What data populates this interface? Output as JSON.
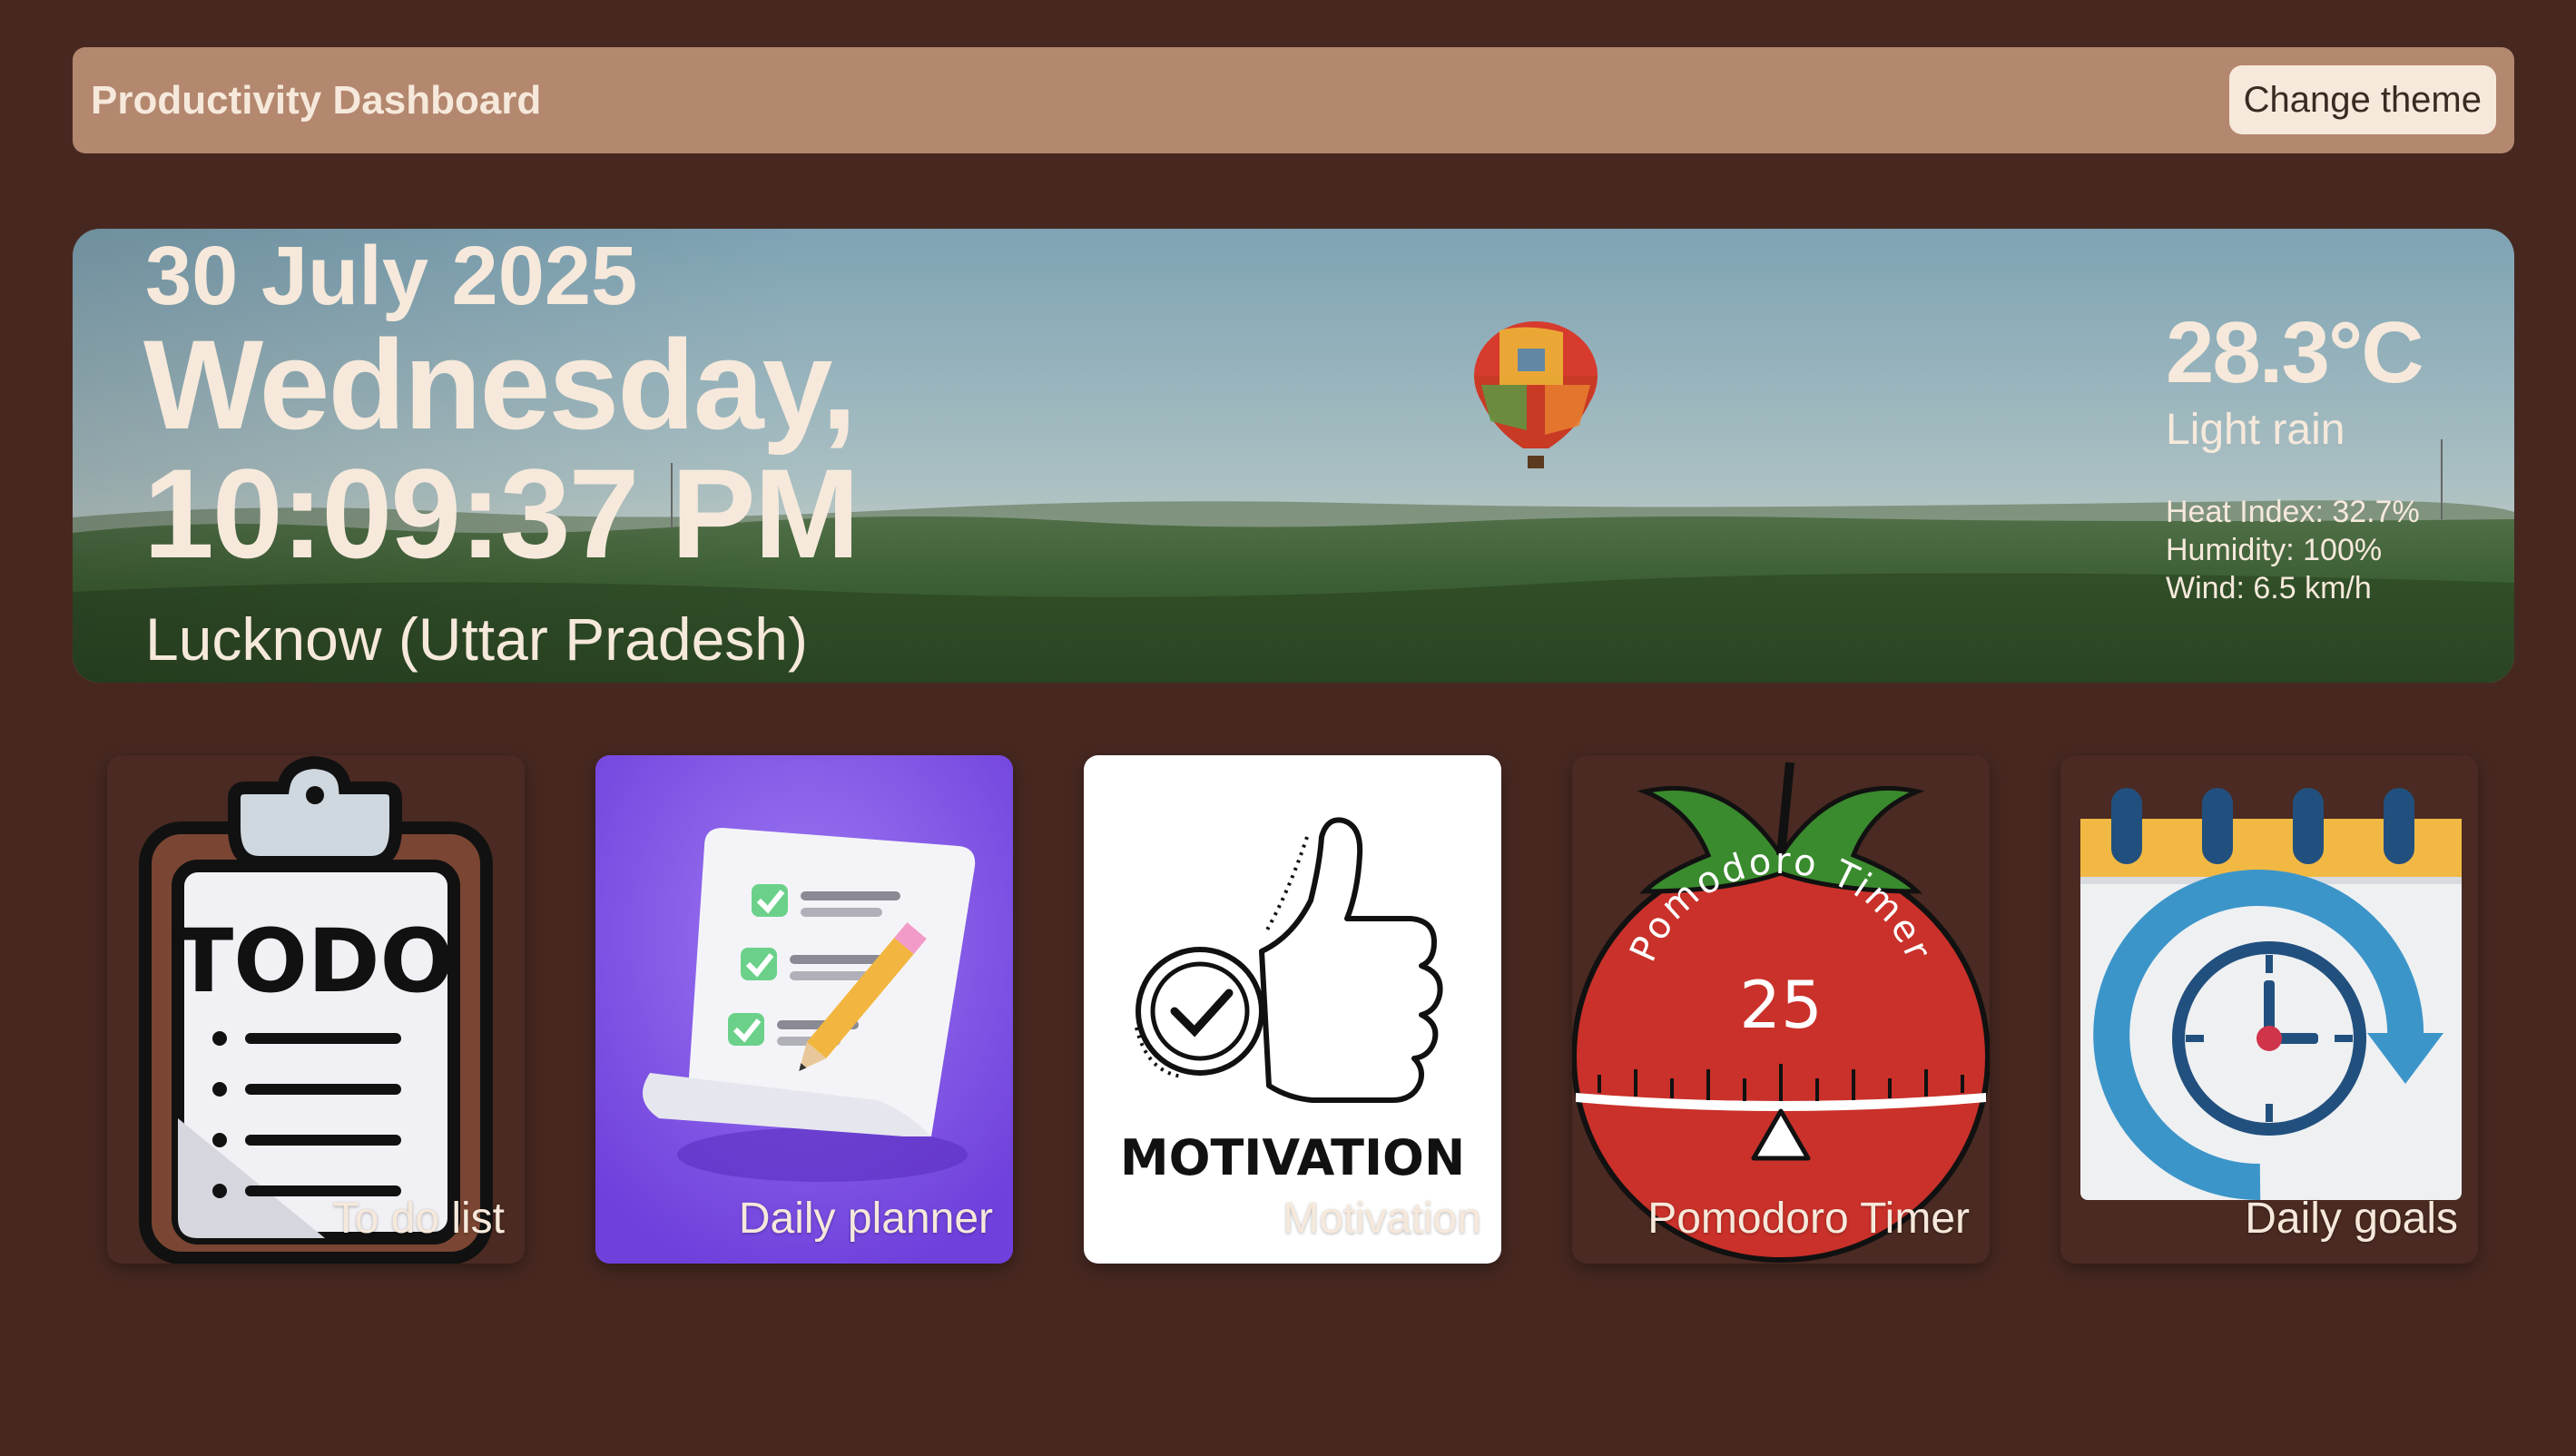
{
  "header": {
    "title": "Productivity Dashboard",
    "theme_button": "Change theme"
  },
  "hero": {
    "date": "30 July 2025",
    "weekday": "Wednesday,",
    "time": "10:09:37 PM",
    "location": "Lucknow (Uttar Pradesh)",
    "temperature": "28.3°C",
    "condition": "Light rain",
    "heat_index": "Heat Index: 32.7%",
    "humidity": "Humidity: 100%",
    "wind": "Wind: 6.5 km/h"
  },
  "cards": [
    {
      "label": "To do list",
      "icon": "todo-clipboard-icon",
      "art_text": "TODO"
    },
    {
      "label": "Daily planner",
      "icon": "planner-checklist-icon"
    },
    {
      "label": "Motivation",
      "icon": "thumbs-up-icon",
      "art_text": "MOTIVATION"
    },
    {
      "label": "Pomodoro Timer",
      "icon": "tomato-timer-icon",
      "art_text": "Pomodoro Timer",
      "art_number": "25"
    },
    {
      "label": "Daily goals",
      "icon": "calendar-clock-icon"
    }
  ],
  "colors": {
    "background": "#472821",
    "header": "#b4876f",
    "text_light": "#f6e9db",
    "card_dark": "#4a2a22",
    "planner_purple": "#8a5ee8"
  }
}
